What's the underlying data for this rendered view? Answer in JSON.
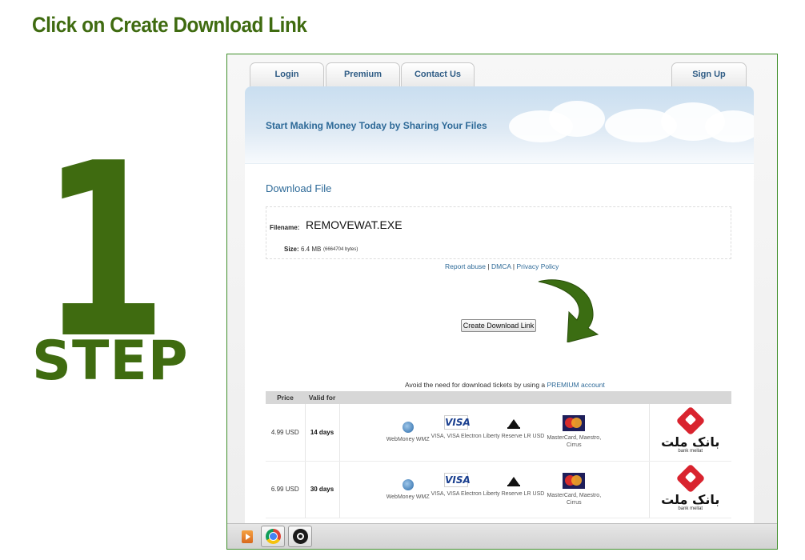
{
  "heading": "Click on Create Download Link",
  "step": {
    "number": "1",
    "word": "STEP"
  },
  "nav": {
    "login": "Login",
    "premium": "Premium",
    "contact": "Contact Us",
    "signup": "Sign Up"
  },
  "banner": {
    "tagline": "Start Making Money Today by Sharing Your Files"
  },
  "download": {
    "title": "Download File",
    "filename_label": "Filename:",
    "filename": "REMOVEWAT.EXE",
    "size_label": "Size:",
    "size": "6.4 MB",
    "size_bytes": "(6664704 bytes)"
  },
  "links": {
    "report": "Report abuse",
    "sep1": " | ",
    "dmca": "DMCA",
    "sep2": " | ",
    "privacy": "Privacy Policy"
  },
  "create_button": "Create Download Link",
  "avoid": {
    "text": "Avoid the need for download tickets by using a ",
    "link": "PREMIUM account"
  },
  "pricing": {
    "headers": {
      "price": "Price",
      "valid": "Valid for",
      "methods": "",
      "bank": ""
    },
    "rows": [
      {
        "price": "4.99 USD",
        "valid": "14 days"
      },
      {
        "price": "6.99 USD",
        "valid": "30 days"
      }
    ],
    "methods": [
      {
        "icon": "webmoney-icon",
        "label": "WebMoney WMZ"
      },
      {
        "icon": "visa-icon",
        "logo": "VISA",
        "label": "VISA, VISA Electron"
      },
      {
        "icon": "liberty-reserve-icon",
        "label": "Liberty Reserve LR USD"
      },
      {
        "icon": "mastercard-icon",
        "label": "MasterCard, Maestro, Cirrus"
      }
    ],
    "bank": {
      "name_fa": "بانک ملت",
      "name_en": "bank mellat"
    }
  },
  "colors": {
    "accent_green": "#3f6b10",
    "link_blue": "#2e6a98",
    "arrow_green": "#3b6d12"
  },
  "taskbar": [
    "media-player-icon",
    "chrome-icon",
    "obs-icon"
  ]
}
